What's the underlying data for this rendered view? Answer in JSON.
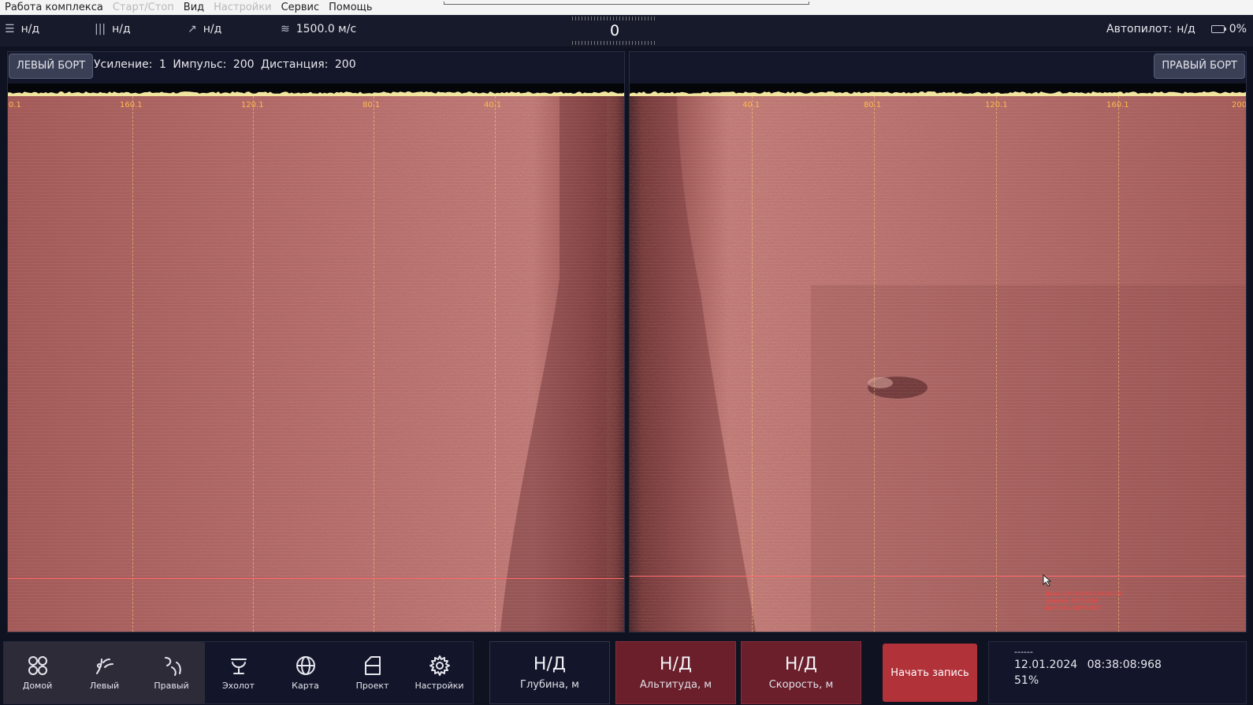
{
  "menu": {
    "items": [
      {
        "label": "Работа комплекса",
        "enabled": true
      },
      {
        "label": "Старт/Стоп",
        "enabled": false
      },
      {
        "label": "Вид",
        "enabled": true
      },
      {
        "label": "Настройки",
        "enabled": false
      },
      {
        "label": "Сервис",
        "enabled": true
      },
      {
        "label": "Помощь",
        "enabled": true
      }
    ]
  },
  "status": {
    "nav_value": "н/д",
    "signal_value": "н/д",
    "course_value": "н/д",
    "sound_speed": "1500.0 м/с",
    "heading": "0",
    "autopilot_label": "Автопилот:",
    "autopilot_value": "н/д",
    "battery_text": "0%",
    "battery_level": 0
  },
  "left": {
    "title": "ЛЕВЫЙ БОРТ",
    "gain_label": "Усиление:",
    "gain_value": "1",
    "pulse_label": "Импульс:",
    "pulse_value": "200",
    "range_label": "Дистанция:",
    "range_value": "200",
    "ticks": [
      "0.1",
      "160.1",
      "120.1",
      "80.1",
      "40.1"
    ]
  },
  "right": {
    "title": "ПРАВЫЙ БОРТ",
    "ticks": [
      "40.1",
      "80.1",
      "120.1",
      "160.1",
      "200"
    ]
  },
  "cursor_readout": {
    "line1": "Дата: 03-10-2023 10:34:23",
    "line2": "Широта: 50°0.000'",
    "line3": "Долгота: W0°0.000'"
  },
  "nav": [
    {
      "label": "Домой",
      "icon": "home-grid-icon",
      "selected": true
    },
    {
      "label": "Левый",
      "icon": "left-sonar-icon",
      "selected": true
    },
    {
      "label": "Правый",
      "icon": "right-sonar-icon",
      "selected": true
    },
    {
      "label": "Эхолот",
      "icon": "echo-sounder-icon",
      "selected": false
    },
    {
      "label": "Карта",
      "icon": "globe-icon",
      "selected": false
    },
    {
      "label": "Проект",
      "icon": "folder-icon",
      "selected": false
    },
    {
      "label": "Настройки",
      "icon": "gear-icon",
      "selected": false
    }
  ],
  "metrics": {
    "depth": {
      "value": "Н/Д",
      "label": "Глубина, м"
    },
    "altitude": {
      "value": "Н/Д",
      "label": "Альтитуда, м"
    },
    "speed": {
      "value": "Н/Д",
      "label": "Скорость, м"
    }
  },
  "record_button": "Начать запись",
  "info": {
    "dashes": "------",
    "date": "12.01.2024",
    "time": "08:38:08:968",
    "percent": "51%"
  },
  "colors": {
    "sonar_base": "#b86f6a",
    "record_red": "#b2323a",
    "metric_red": "#6a1f2b",
    "tick_orange": "#ffb84d",
    "cursor_line": "#ff6a6a"
  }
}
